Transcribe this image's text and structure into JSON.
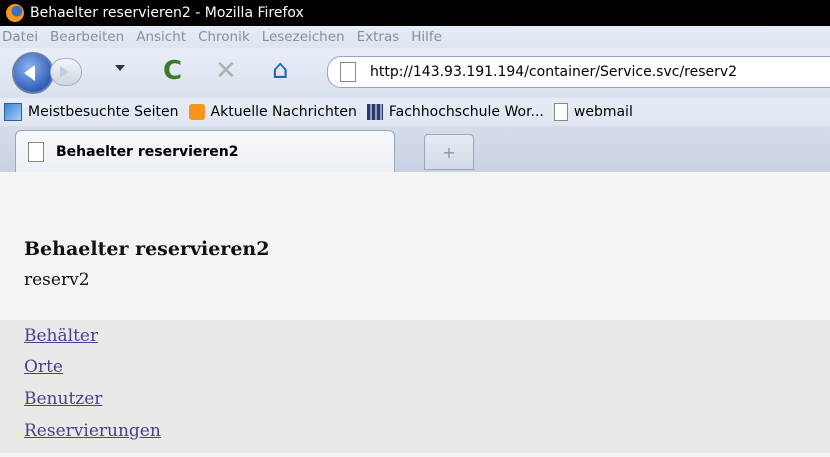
{
  "window": {
    "title": "Behaelter reservieren2 - Mozilla Firefox"
  },
  "menu": {
    "items": [
      {
        "label": "Datei"
      },
      {
        "label": "Bearbeiten"
      },
      {
        "label": "Ansicht"
      },
      {
        "label": "Chronik"
      },
      {
        "label": "Lesezeichen"
      },
      {
        "label": "Extras"
      },
      {
        "label": "Hilfe"
      }
    ]
  },
  "nav": {
    "url": "http://143.93.191.194/container/Service.svc/reserv2",
    "icons": [
      "back-icon",
      "forward-icon",
      "dropdown-icon",
      "reload-icon",
      "stop-icon",
      "home-icon"
    ]
  },
  "bookmarks": [
    {
      "label": "Meistbesuchte Seiten",
      "icon": "bookmark-icon"
    },
    {
      "label": "Aktuelle Nachrichten",
      "icon": "rss-icon"
    },
    {
      "label": "Fachhochschule Wor...",
      "icon": "site-icon"
    },
    {
      "label": "webmail",
      "icon": "page-icon"
    }
  ],
  "tabs": [
    {
      "label": "Behaelter reservieren2"
    }
  ],
  "page": {
    "heading": "Behaelter reservieren2",
    "subtitle": "reserv2",
    "links": [
      {
        "label": "Behälter"
      },
      {
        "label": "Orte"
      },
      {
        "label": "Benutzer"
      },
      {
        "label": "Reservierungen"
      }
    ]
  }
}
